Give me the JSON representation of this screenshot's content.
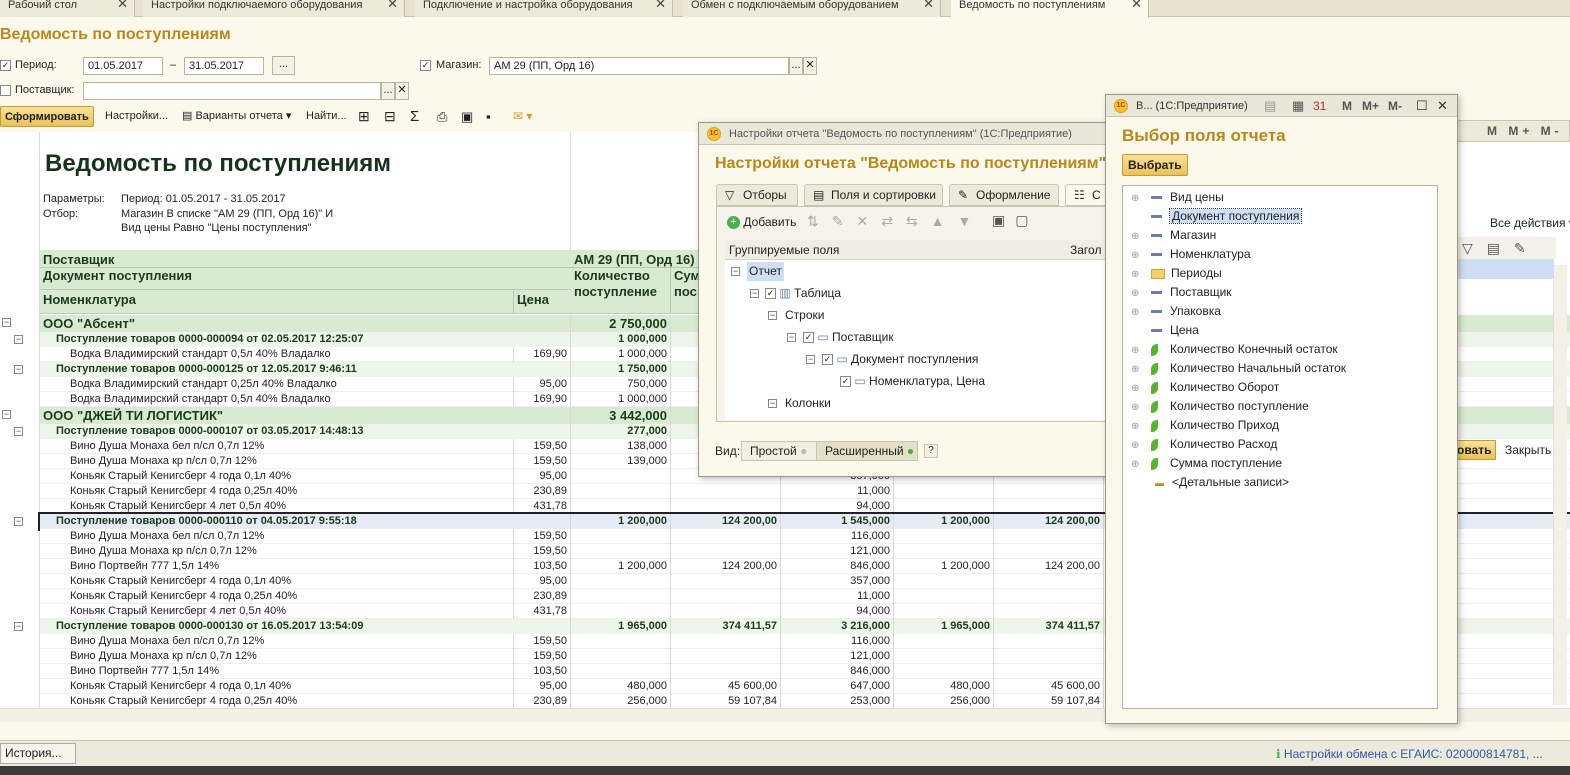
{
  "tabs": [
    {
      "label": "Рабочий стол"
    },
    {
      "label": "Настройки подключаемого оборудования"
    },
    {
      "label": "Подключение и настройка оборудования"
    },
    {
      "label": "Обмен с подключаемым оборудованием"
    },
    {
      "label": "Ведомость по поступлениям"
    }
  ],
  "page_title": "Ведомость по поступлениям",
  "filters": {
    "period_label": "Период:",
    "date_from": "01.05.2017",
    "dash": "–",
    "date_to": "31.05.2017",
    "store_label": "Магазин:",
    "store_value": "АМ 29 (ПП, Орд 16)",
    "supplier_label": "Поставщик:",
    "supplier_value": "",
    "ellipsis": "..."
  },
  "toolbar": {
    "generate": "Сформировать",
    "settings": "Настройки...",
    "variants": "Варианты отчета",
    "find": "Найти...",
    "all_actions": "Все действия"
  },
  "report": {
    "title": "Ведомость по поступлениям",
    "params_label": "Параметры:",
    "params_value": "Период: 01.05.2017 - 31.05.2017",
    "filter_label": "Отбор:",
    "filter_line1": "Магазин В списке \"АМ 29 (ПП, Орд 16)\" И",
    "filter_line2": "Вид цены Равно \"Цены поступления\"",
    "h_supplier": "Поставщик",
    "h_doc": "Документ поступления",
    "h_item": "Номенклатура",
    "h_price": "Цена",
    "h_store": "АМ 29 (ПП, Орд 16)",
    "h_qty": "Количество поступление",
    "h_sum": "Сум пос"
  },
  "rows": [
    {
      "type": "g1",
      "name": "ООО \"Абсент\"",
      "price": "",
      "c1": "2 750,000",
      "c2": "",
      "c3": "",
      "c4": "",
      "c5": ""
    },
    {
      "type": "g2",
      "name": "Поступление товаров 0000-000094 от 02.05.2017 12:25:07",
      "price": "",
      "c1": "1 000,000",
      "c2": "",
      "c3": "",
      "c4": "",
      "c5": ""
    },
    {
      "type": "d",
      "name": "Водка Владимирский стандарт 0,5л 40% Владалко",
      "price": "169,90",
      "c1": "1 000,000",
      "c2": "",
      "c3": "",
      "c4": "",
      "c5": ""
    },
    {
      "type": "g2",
      "name": "Поступление товаров 0000-000125 от 12.05.2017 9:46:11",
      "price": "",
      "c1": "1 750,000",
      "c2": "",
      "c3": "",
      "c4": "",
      "c5": ""
    },
    {
      "type": "d",
      "name": "Водка Владимирский стандарт 0,25л 40% Владалко",
      "price": "95,00",
      "c1": "750,000",
      "c2": "",
      "c3": "",
      "c4": "",
      "c5": ""
    },
    {
      "type": "d",
      "name": "Водка Владимирский стандарт 0,5л 40% Владалко",
      "price": "169,90",
      "c1": "1 000,000",
      "c2": "",
      "c3": "",
      "c4": "",
      "c5": ""
    },
    {
      "type": "g1",
      "name": "ООО \"ДЖЕЙ ТИ ЛОГИСТИК\"",
      "price": "",
      "c1": "3 442,000",
      "c2": "",
      "c3": "",
      "c4": "",
      "c5": ""
    },
    {
      "type": "g2",
      "name": "Поступление товаров 0000-000107 от 03.05.2017 14:48:13",
      "price": "",
      "c1": "277,000",
      "c2": "",
      "c3": "",
      "c4": "",
      "c5": ""
    },
    {
      "type": "d",
      "name": "Вино Душа Монаха бел п/сл 0,7л 12%",
      "price": "159,50",
      "c1": "138,000",
      "c2": "",
      "c3": "",
      "c4": "",
      "c5": ""
    },
    {
      "type": "d",
      "name": "Вино Душа Монаха кр п/сл 0,7л 12%",
      "price": "159,50",
      "c1": "139,000",
      "c2": "",
      "c3": "",
      "c4": "",
      "c5": ""
    },
    {
      "type": "d",
      "name": "Коньяк Старый Кенигсберг 4 года 0,1л 40%",
      "price": "95,00",
      "c1": "",
      "c2": "",
      "c3": "357,000",
      "c4": "",
      "c5": ""
    },
    {
      "type": "d",
      "name": "Коньяк Старый Кенигсберг 4 года 0,25л 40%",
      "price": "230,89",
      "c1": "",
      "c2": "",
      "c3": "11,000",
      "c4": "",
      "c5": ""
    },
    {
      "type": "d",
      "name": "Коньяк Старый Кенигсберг 4 лет 0,5л 40%",
      "price": "431,78",
      "c1": "",
      "c2": "",
      "c3": "94,000",
      "c4": "",
      "c5": ""
    },
    {
      "type": "g2",
      "sel": true,
      "name": "Поступление товаров 0000-000110 от 04.05.2017 9:55:18",
      "price": "",
      "c1": "1 200,000",
      "c2": "124 200,00",
      "c3": "1 545,000",
      "c4": "1 200,000",
      "c5": "124 200,00"
    },
    {
      "type": "d",
      "name": "Вино Душа Монаха бел п/сл 0,7л 12%",
      "price": "159,50",
      "c1": "",
      "c2": "",
      "c3": "116,000",
      "c4": "",
      "c5": ""
    },
    {
      "type": "d",
      "name": "Вино Душа Монаха кр п/сл 0,7л 12%",
      "price": "159,50",
      "c1": "",
      "c2": "",
      "c3": "121,000",
      "c4": "",
      "c5": ""
    },
    {
      "type": "d",
      "name": "Вино Портвейн 777 1,5л 14%",
      "price": "103,50",
      "c1": "1 200,000",
      "c2": "124 200,00",
      "c3": "846,000",
      "c4": "1 200,000",
      "c5": "124 200,00"
    },
    {
      "type": "d",
      "name": "Коньяк Старый Кенигсберг 4 года 0,1л 40%",
      "price": "95,00",
      "c1": "",
      "c2": "",
      "c3": "357,000",
      "c4": "",
      "c5": ""
    },
    {
      "type": "d",
      "name": "Коньяк Старый Кенигсберг 4 года 0,25л 40%",
      "price": "230,89",
      "c1": "",
      "c2": "",
      "c3": "11,000",
      "c4": "",
      "c5": ""
    },
    {
      "type": "d",
      "name": "Коньяк Старый Кенигсберг 4 лет 0,5л 40%",
      "price": "431,78",
      "c1": "",
      "c2": "",
      "c3": "94,000",
      "c4": "",
      "c5": ""
    },
    {
      "type": "g2",
      "name": "Поступление товаров 0000-000130 от 16.05.2017 13:54:09",
      "price": "",
      "c1": "1 965,000",
      "c2": "374 411,57",
      "c3": "3 216,000",
      "c4": "1 965,000",
      "c5": "374 411,57"
    },
    {
      "type": "d",
      "name": "Вино Душа Монаха бел п/сл 0,7л 12%",
      "price": "159,50",
      "c1": "",
      "c2": "",
      "c3": "116,000",
      "c4": "",
      "c5": ""
    },
    {
      "type": "d",
      "name": "Вино Душа Монаха кр п/сл 0,7л 12%",
      "price": "159,50",
      "c1": "",
      "c2": "",
      "c3": "121,000",
      "c4": "",
      "c5": ""
    },
    {
      "type": "d",
      "name": "Вино Портвейн 777 1,5л 14%",
      "price": "103,50",
      "c1": "",
      "c2": "",
      "c3": "846,000",
      "c4": "",
      "c5": ""
    },
    {
      "type": "d",
      "name": "Коньяк Старый Кенигсберг 4 года 0,1л 40%",
      "price": "95,00",
      "c1": "480,000",
      "c2": "45 600,00",
      "c3": "647,000",
      "c4": "480,000",
      "c5": "45 600,00"
    },
    {
      "type": "d",
      "name": "Коньяк Старый Кенигсберг 4 года 0,25л 40%",
      "price": "230,89",
      "c1": "256,000",
      "c2": "59 107,84",
      "c3": "253,000",
      "c4": "256,000",
      "c5": "59 107,84"
    }
  ],
  "settings_window": {
    "title": "Настройки отчета \"Ведомость по поступлениям\"  (1С:Предприятие)",
    "heading": "Настройки отчета \"Ведомость по поступлениям\"",
    "tabs": [
      "Отборы",
      "Поля и сортировки",
      "Оформление",
      "С"
    ],
    "add": "Добавить",
    "col_fields": "Группируемые поля",
    "col_title": "Загол",
    "tree": [
      {
        "label": "Отчет"
      },
      {
        "label": "Таблица"
      },
      {
        "label": "Строки"
      },
      {
        "label": "Поставщик"
      },
      {
        "label": "Документ поступления"
      },
      {
        "label": "Номенклатура, Цена"
      },
      {
        "label": "Колонки"
      }
    ],
    "view_label": "Вид:",
    "view_simple": "Простой",
    "view_extended": "Расширенный",
    "help": "?"
  },
  "right_fragment": {
    "all_actions": "Все действия",
    "select_partial": "овать",
    "close": "Закрыть"
  },
  "field_window": {
    "title": "В...  (1С:Предприятие)",
    "heading": "Выбор поля отчета",
    "select": "Выбрать",
    "m1": "M",
    "m2": "M+",
    "m3": "M-",
    "fields": [
      {
        "label": "Вид цены",
        "icon": "dash"
      },
      {
        "label": "Документ поступления",
        "icon": "dash"
      },
      {
        "label": "Магазин",
        "icon": "dash"
      },
      {
        "label": "Номенклатура",
        "icon": "dash"
      },
      {
        "label": "Периоды",
        "icon": "folder"
      },
      {
        "label": "Поставщик",
        "icon": "dash"
      },
      {
        "label": "Упаковка",
        "icon": "dash"
      },
      {
        "label": "Цена",
        "icon": "dash"
      },
      {
        "label": "Количество Конечный остаток",
        "icon": "leaf"
      },
      {
        "label": "Количество Начальный остаток",
        "icon": "leaf"
      },
      {
        "label": "Количество Оборот",
        "icon": "leaf"
      },
      {
        "label": "Количество поступление",
        "icon": "leaf"
      },
      {
        "label": "Количество Приход",
        "icon": "leaf"
      },
      {
        "label": "Количество Расход",
        "icon": "leaf"
      },
      {
        "label": "Сумма поступление",
        "icon": "leaf"
      },
      {
        "label": "<Детальные записи>",
        "icon": "detail"
      }
    ]
  },
  "status": {
    "history": "История...",
    "egais": "Настройки обмена с ЕГАИС: 020000814781, ..."
  }
}
